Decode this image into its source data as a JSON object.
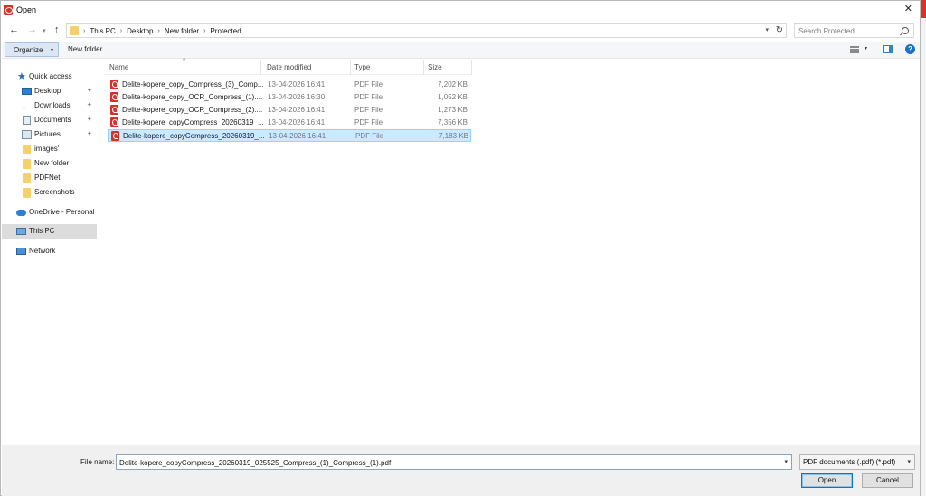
{
  "window": {
    "title": "Open",
    "close_label": "✕"
  },
  "nav": {
    "back_glyph": "←",
    "forward_glyph": "→",
    "history_glyph": "▾",
    "up_glyph": "↑"
  },
  "address": {
    "crumbs": [
      "This PC",
      "Desktop",
      "New folder",
      "Protected"
    ],
    "separator": "›",
    "refresh_glyph": "↻",
    "dropdown_glyph": "▾"
  },
  "search": {
    "placeholder": "Search Protected"
  },
  "toolbar": {
    "organize_label": "Organize",
    "organize_dd": "▾",
    "new_folder_label": "New folder",
    "view_dd": "▾",
    "help_label": "?"
  },
  "sidebar": {
    "pin_glyph": "✦",
    "items": [
      {
        "label": "Quick access",
        "icon": "star-icon"
      },
      {
        "label": "Desktop",
        "icon": "desktop-icon",
        "pinned": true
      },
      {
        "label": "Downloads",
        "icon": "download-icon",
        "pinned": true
      },
      {
        "label": "Documents",
        "icon": "documents-icon",
        "pinned": true
      },
      {
        "label": "Pictures",
        "icon": "pictures-icon",
        "pinned": true
      },
      {
        "label": "images'",
        "icon": "folder-icon"
      },
      {
        "label": "New folder",
        "icon": "folder-icon"
      },
      {
        "label": "PDFNet",
        "icon": "folder-icon"
      },
      {
        "label": "Screenshots",
        "icon": "folder-icon"
      },
      {
        "label": "OneDrive - Personal",
        "icon": "cloud-icon"
      },
      {
        "label": "This PC",
        "icon": "pc-icon",
        "selected": true
      },
      {
        "label": "Network",
        "icon": "network-icon"
      }
    ]
  },
  "columns": {
    "name": "Name",
    "date": "Date modified",
    "type": "Type",
    "size": "Size",
    "sort_glyph": "^"
  },
  "files": [
    {
      "name": "Delite-kopere_copy_Compress_(3)_Comp...",
      "date": "13-04-2026 16:41",
      "type": "PDF File",
      "size": "7,202 KB"
    },
    {
      "name": "Delite-kopere_copy_OCR_Compress_(1)....",
      "date": "13-04-2026 16:30",
      "type": "PDF File",
      "size": "1,052 KB"
    },
    {
      "name": "Delite-kopere_copy_OCR_Compress_(2)....",
      "date": "13-04-2026 16:41",
      "type": "PDF File",
      "size": "1,273 KB"
    },
    {
      "name": "Delite-kopere_copyCompress_20260319_...",
      "date": "13-04-2026 16:41",
      "type": "PDF File",
      "size": "7,356 KB"
    },
    {
      "name": "Delite-kopere_copyCompress_20260319_...",
      "date": "13-04-2026 16:41",
      "type": "PDF File",
      "size": "7,183 KB",
      "selected": true
    }
  ],
  "footer": {
    "file_name_label": "File name:",
    "file_name_value": "Delite-kopere_copyCompress_20260319_025525_Compress_(1)_Compress_(1).pdf",
    "file_type": "PDF documents (.pdf) (*.pdf)",
    "dd_glyph": "▾",
    "open_label": "Open",
    "cancel_label": "Cancel"
  },
  "colors": {
    "accent": "#0078d7",
    "selected_row": "#cde8ff",
    "pdf_red": "#d6322a"
  }
}
